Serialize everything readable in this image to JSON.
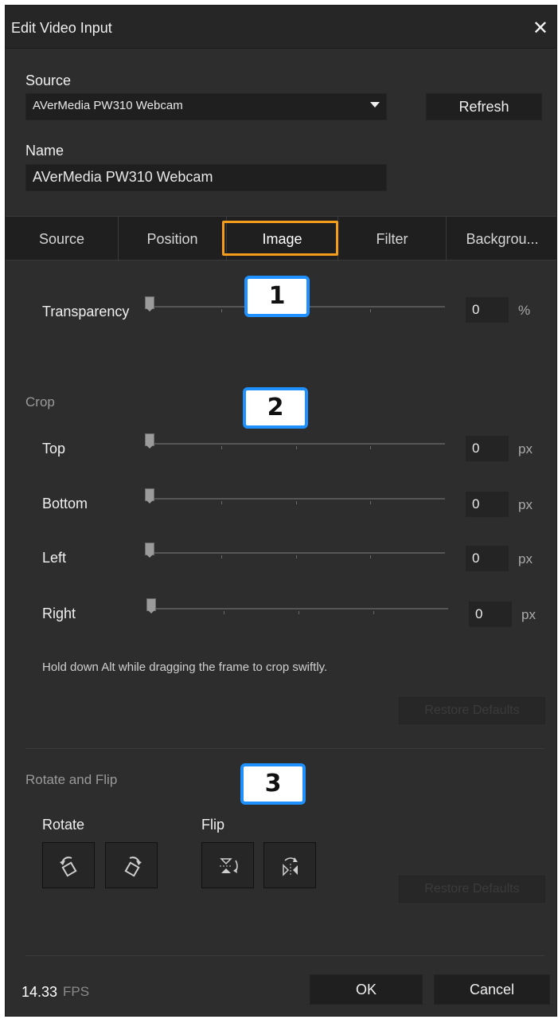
{
  "dialog": {
    "title": "Edit Video Input",
    "close_label": "✕"
  },
  "source": {
    "label": "Source",
    "value": "AVerMedia PW310 Webcam",
    "refresh_label": "Refresh"
  },
  "name": {
    "label": "Name",
    "value": "AVerMedia PW310 Webcam"
  },
  "tabs": [
    {
      "label": "Source"
    },
    {
      "label": "Position"
    },
    {
      "label": "Image",
      "active": true
    },
    {
      "label": "Filter"
    },
    {
      "label": "Backgrou..."
    }
  ],
  "transparency": {
    "label": "Transparency",
    "value": "0",
    "unit": "%",
    "level": 0
  },
  "crop": {
    "title": "Crop",
    "rows": [
      {
        "label": "Top",
        "value": "0",
        "unit": "px",
        "level": 0
      },
      {
        "label": "Bottom",
        "value": "0",
        "unit": "px",
        "level": 0
      },
      {
        "label": "Left",
        "value": "0",
        "unit": "px",
        "level": 0
      },
      {
        "label": "Right",
        "value": "0",
        "unit": "px",
        "level": 0
      }
    ],
    "hint": "Hold down Alt while dragging the frame to crop swiftly.",
    "restore_label": "Restore Defaults"
  },
  "rotate_flip": {
    "title": "Rotate and Flip",
    "rotate_label": "Rotate",
    "flip_label": "Flip",
    "restore_label": "Restore Defaults"
  },
  "badges": {
    "one": "1",
    "two": "2",
    "three": "3"
  },
  "footer": {
    "fps_value": "14.33",
    "fps_unit": "FPS",
    "ok_label": "OK",
    "cancel_label": "Cancel"
  },
  "colors": {
    "tab_highlight": "#f59c1a",
    "badge_border": "#1e90ff",
    "background": "#2d2d2d"
  }
}
